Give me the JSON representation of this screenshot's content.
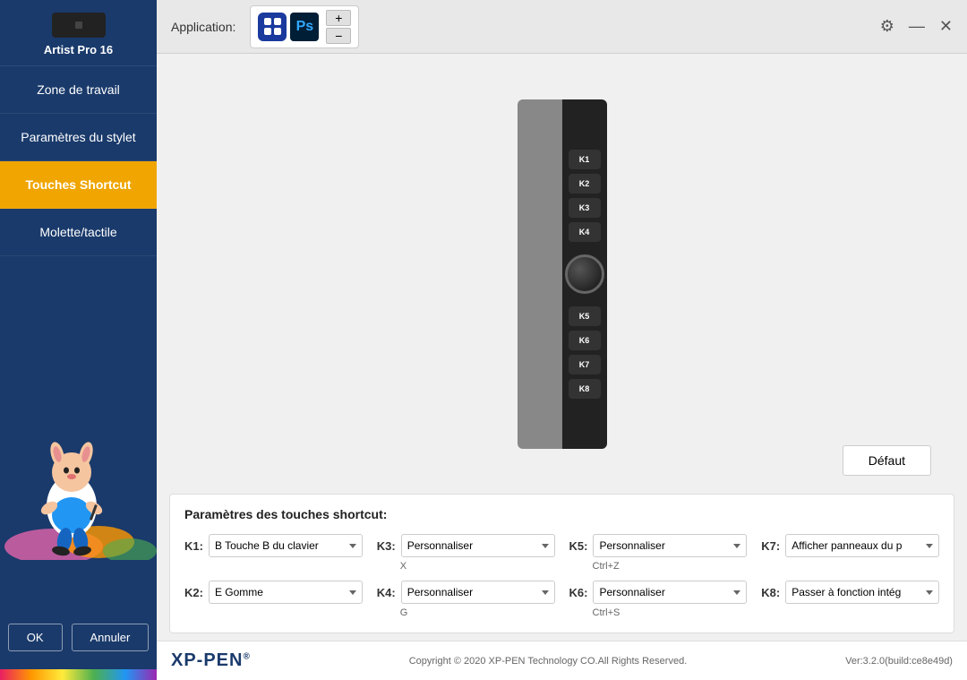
{
  "sidebar": {
    "device_name": "Artist Pro 16",
    "nav_items": [
      {
        "id": "zone-travail",
        "label": "Zone de travail",
        "active": false
      },
      {
        "id": "parametres-stylet",
        "label": "Paramètres du stylet",
        "active": false
      },
      {
        "id": "touches-shortcut",
        "label": "Touches Shortcut",
        "active": true
      },
      {
        "id": "molette-tactile",
        "label": "Molette/tactile",
        "active": false
      }
    ],
    "ok_label": "OK",
    "cancel_label": "Annuler"
  },
  "topbar": {
    "app_label": "Application:",
    "ps_label": "Ps",
    "add_label": "+",
    "remove_label": "−"
  },
  "device": {
    "keys_top": [
      "K1",
      "K2",
      "K3",
      "K4"
    ],
    "keys_bottom": [
      "K5",
      "K6",
      "K7",
      "K8"
    ]
  },
  "defaut_label": "Défaut",
  "bottom_panel": {
    "title": "Paramètres des touches shortcut:",
    "keys": [
      {
        "id": "K1",
        "label": "K1",
        "value": "B Touche B du clavier",
        "sub": ""
      },
      {
        "id": "K2",
        "label": "K2",
        "value": "E Gomme",
        "sub": ""
      },
      {
        "id": "K3",
        "label": "K3",
        "value": "Personnaliser",
        "sub": "X"
      },
      {
        "id": "K4",
        "label": "K4",
        "value": "Personnaliser",
        "sub": "G"
      },
      {
        "id": "K5",
        "label": "K5",
        "value": "Personnaliser",
        "sub": "Ctrl+Z"
      },
      {
        "id": "K6",
        "label": "K6",
        "value": "Personnaliser",
        "sub": "Ctrl+S"
      },
      {
        "id": "K7",
        "label": "K7",
        "value": "Afficher panneaux du p",
        "sub": ""
      },
      {
        "id": "K8",
        "label": "K8",
        "value": "Passer à fonction intég",
        "sub": ""
      }
    ]
  },
  "footer": {
    "brand": "XP-PEN",
    "brand_superscript": "®",
    "copyright": "Copyright © 2020 XP-PEN Technology CO.All Rights Reserved.",
    "version": "Ver:3.2.0(build:ce8e49d)"
  }
}
